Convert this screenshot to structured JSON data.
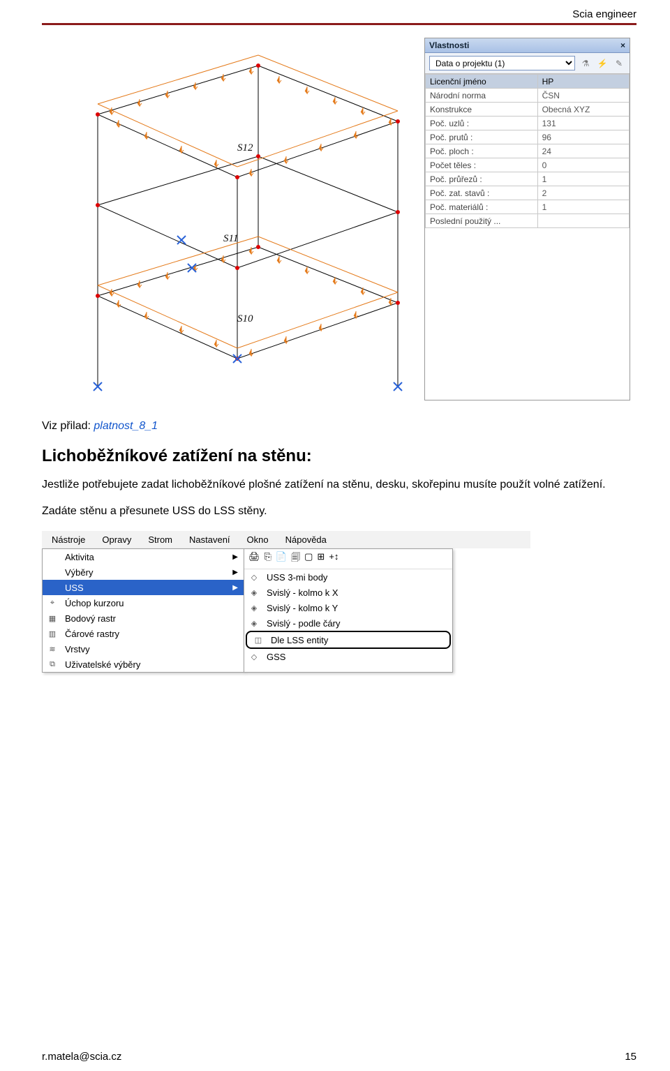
{
  "header": {
    "product_name": "Scia engineer"
  },
  "properties_panel": {
    "title": "Vlastnosti",
    "selector": "Data o projektu (1)",
    "icons": {
      "filter": "⚗",
      "bolt": "⚡",
      "edit": "✎"
    },
    "rows": [
      {
        "label": "Licenční jméno",
        "value": "HP",
        "selected": true
      },
      {
        "label": "Národní norma",
        "value": "ČSN",
        "selected": false
      },
      {
        "label": "Konstrukce",
        "value": "Obecná XYZ",
        "selected": false
      },
      {
        "label": "Poč. uzlů :",
        "value": "131",
        "selected": false
      },
      {
        "label": "Poč. prutů :",
        "value": "96",
        "selected": false
      },
      {
        "label": "Poč. ploch :",
        "value": "24",
        "selected": false
      },
      {
        "label": "Počet těles :",
        "value": "0",
        "selected": false
      },
      {
        "label": "Poč. průřezů :",
        "value": "1",
        "selected": false
      },
      {
        "label": "Poč. zat. stavů :",
        "value": "2",
        "selected": false
      },
      {
        "label": "Poč. materiálů :",
        "value": "1",
        "selected": false
      },
      {
        "label": "Poslední použitý ...",
        "value": "",
        "selected": false
      }
    ]
  },
  "structure_labels": {
    "s12": "S12",
    "s11": "S11",
    "s10": "S10"
  },
  "body": {
    "viz_prefix": "Viz přilad: ",
    "viz_link": "platnost_8_1",
    "section_head": "Lichoběžníkové zatížení na stěnu:",
    "para1": "Jestliže potřebujete zadat lichoběžníkové plošné zatížení na stěnu, desku, skořepinu musíte použít volné zatížení.",
    "para2": "Zadáte stěnu a přesunete USS do LSS stěny."
  },
  "menu": {
    "top_items": [
      "Nástroje",
      "Opravy",
      "Strom",
      "Nastavení",
      "Okno",
      "Nápověda"
    ],
    "left": [
      {
        "label": "Aktivita",
        "arrow": true,
        "sel": false,
        "icon": ""
      },
      {
        "label": "Výběry",
        "arrow": true,
        "sel": false,
        "icon": ""
      },
      {
        "label": "USS",
        "arrow": true,
        "sel": true,
        "icon": ""
      },
      {
        "label": "Úchop kurzoru",
        "arrow": false,
        "sel": false,
        "icon": "⌖"
      },
      {
        "label": "Bodový rastr",
        "arrow": false,
        "sel": false,
        "icon": "▦"
      },
      {
        "label": "Čárové rastry",
        "arrow": false,
        "sel": false,
        "icon": "▥"
      },
      {
        "label": "Vrstvy",
        "arrow": false,
        "sel": false,
        "icon": "≋"
      },
      {
        "label": "Uživatelské výběry",
        "arrow": false,
        "sel": false,
        "icon": "⧉"
      }
    ],
    "right": [
      {
        "label": "USS 3-mi body",
        "icon": "◇",
        "boxed": false
      },
      {
        "label": "Svislý - kolmo k X",
        "icon": "◈",
        "boxed": false
      },
      {
        "label": "Svislý - kolmo k Y",
        "icon": "◈",
        "boxed": false
      },
      {
        "label": "Svislý - podle čáry",
        "icon": "◈",
        "boxed": false
      },
      {
        "label": "Dle LSS entity",
        "icon": "◫",
        "boxed": true
      },
      {
        "label": "GSS",
        "icon": "◇",
        "boxed": false
      }
    ],
    "right_toolbar_icons": [
      "🖨",
      "⎘",
      "📄",
      "🗐",
      "▢",
      "⊞",
      "+↕"
    ]
  },
  "footer": {
    "email": "r.matela@scia.cz",
    "page": "15"
  }
}
